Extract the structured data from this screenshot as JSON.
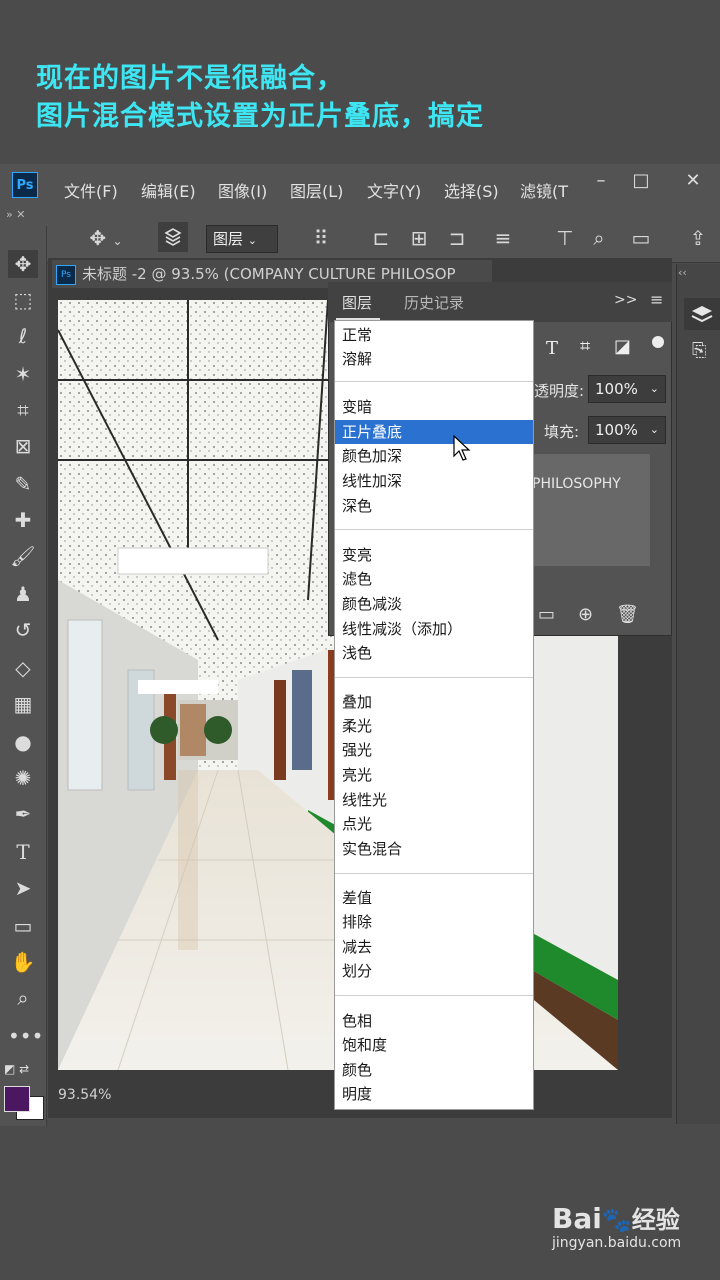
{
  "caption": {
    "line1": "现在的图片不是很融合，",
    "line2": "图片混合模式设置为正片叠底，搞定"
  },
  "app": {
    "logo": "Ps",
    "menu": [
      "文件(F)",
      "编辑(E)",
      "图像(I)",
      "图层(L)",
      "文字(Y)",
      "选择(S)",
      "滤镜(T"
    ],
    "window_buttons": {
      "minimize": "–",
      "restore": "□",
      "close": "✕"
    }
  },
  "options_bar": {
    "target_select": "图层"
  },
  "document": {
    "tab_title": "未标题 -2 @ 93.5% (COMPANY CULTURE  PHILOSOP",
    "tab_logo": "Ps",
    "zoom": "93.54%"
  },
  "layers_panel": {
    "tabs": [
      "图层",
      "历史记录"
    ],
    "opacity_label": "透明度:",
    "opacity_value": "100%",
    "fill_label": "填充:",
    "fill_value": "100%",
    "layer_name": "PHILOSOPHY"
  },
  "blend_modes": {
    "selected": "正片叠底",
    "groups": [
      [
        "正常",
        "溶解"
      ],
      [
        "变暗",
        "正片叠底",
        "颜色加深",
        "线性加深",
        "深色"
      ],
      [
        "变亮",
        "滤色",
        "颜色减淡",
        "线性减淡（添加）",
        "浅色"
      ],
      [
        "叠加",
        "柔光",
        "强光",
        "亮光",
        "线性光",
        "点光",
        "实色混合"
      ],
      [
        "差值",
        "排除",
        "减去",
        "划分"
      ],
      [
        "色相",
        "饱和度",
        "颜色",
        "明度"
      ]
    ]
  },
  "colors": {
    "caption": "#3de6f2",
    "selection": "#2a71d0",
    "foreground_swatch": "#4a1760",
    "background_swatch": "#ffffff"
  },
  "watermark": {
    "brand": "Bai",
    "brand_suffix": "经验",
    "url": "jingyan.baidu.com"
  }
}
